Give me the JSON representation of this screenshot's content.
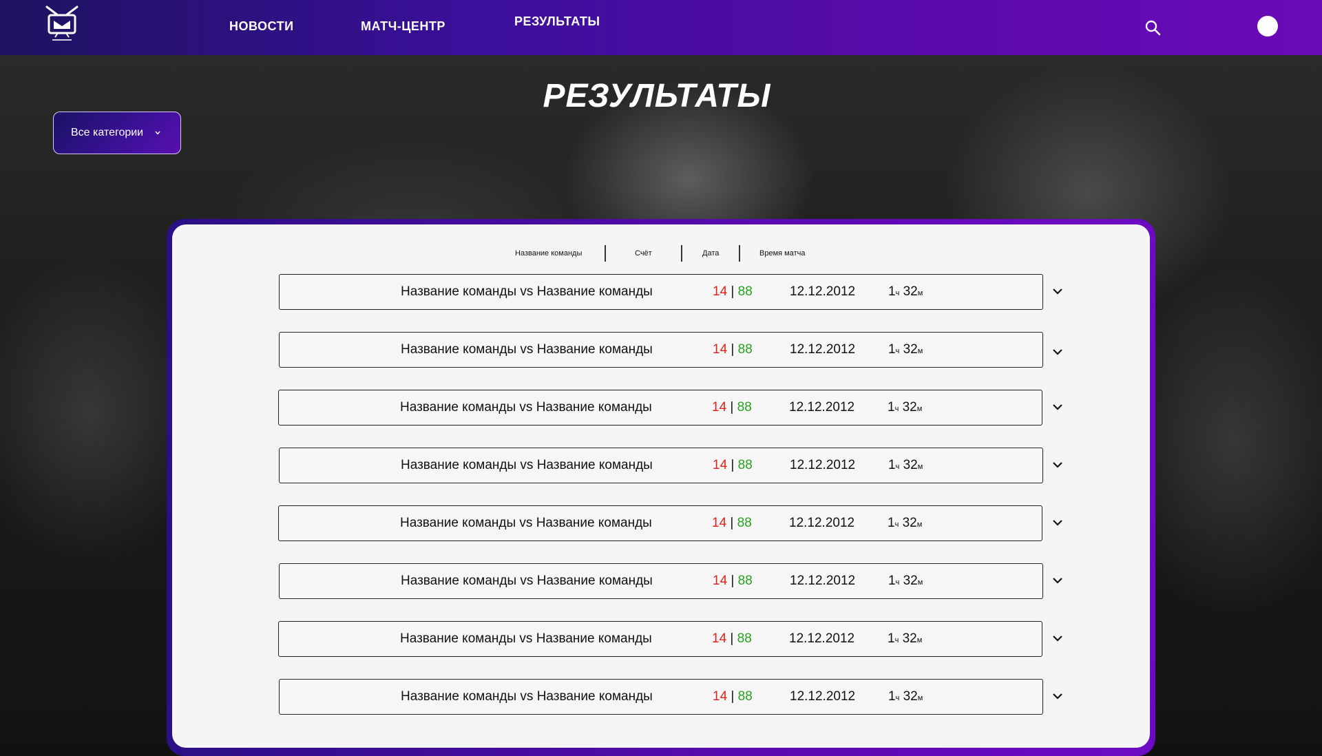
{
  "header": {
    "logo_name": "tv-logo",
    "nav": [
      {
        "label": "НОВОСТИ"
      },
      {
        "label": "МАТЧ-ЦЕНТР"
      },
      {
        "label": "РЕЗУЛЬТАТЫ"
      }
    ],
    "search_icon": "search-icon",
    "avatar_icon": "user-avatar"
  },
  "page": {
    "title": "РЕЗУЛЬТАТЫ",
    "category_label": "Все категории",
    "category_icon": "chevron-down-icon"
  },
  "table": {
    "columns": [
      "Название команды",
      "Счёт",
      "Дата",
      "Время матча"
    ],
    "rows": [
      {
        "teams": "Название команды vs Название команды",
        "score1": "14",
        "score2": "88",
        "date": "12.12.2012",
        "hours": "1",
        "hours_unit": "ч",
        "minutes": "32",
        "minutes_unit": "м"
      },
      {
        "teams": "Название команды vs Название команды",
        "score1": "14",
        "score2": "88",
        "date": "12.12.2012",
        "hours": "1",
        "hours_unit": "ч",
        "minutes": "32",
        "minutes_unit": "м"
      },
      {
        "teams": "Название команды vs Название команды",
        "score1": "14",
        "score2": "88",
        "date": "12.12.2012",
        "hours": "1",
        "hours_unit": "ч",
        "minutes": "32",
        "minutes_unit": "м"
      },
      {
        "teams": "Название команды vs Название команды",
        "score1": "14",
        "score2": "88",
        "date": "12.12.2012",
        "hours": "1",
        "hours_unit": "ч",
        "minutes": "32",
        "minutes_unit": "м"
      },
      {
        "teams": "Название команды vs Название команды",
        "score1": "14",
        "score2": "88",
        "date": "12.12.2012",
        "hours": "1",
        "hours_unit": "ч",
        "minutes": "32",
        "minutes_unit": "м"
      },
      {
        "teams": "Название команды vs Название команды",
        "score1": "14",
        "score2": "88",
        "date": "12.12.2012",
        "hours": "1",
        "hours_unit": "ч",
        "minutes": "32",
        "minutes_unit": "м"
      },
      {
        "teams": "Название команды vs Название команды",
        "score1": "14",
        "score2": "88",
        "date": "12.12.2012",
        "hours": "1",
        "hours_unit": "ч",
        "minutes": "32",
        "minutes_unit": "м"
      },
      {
        "teams": "Название команды vs Название команды",
        "score1": "14",
        "score2": "88",
        "date": "12.12.2012",
        "hours": "1",
        "hours_unit": "ч",
        "minutes": "32",
        "minutes_unit": "м"
      }
    ]
  },
  "colors": {
    "accent": "#5a0aab",
    "score_lose": "#e0201c",
    "score_win": "#27a31c"
  }
}
